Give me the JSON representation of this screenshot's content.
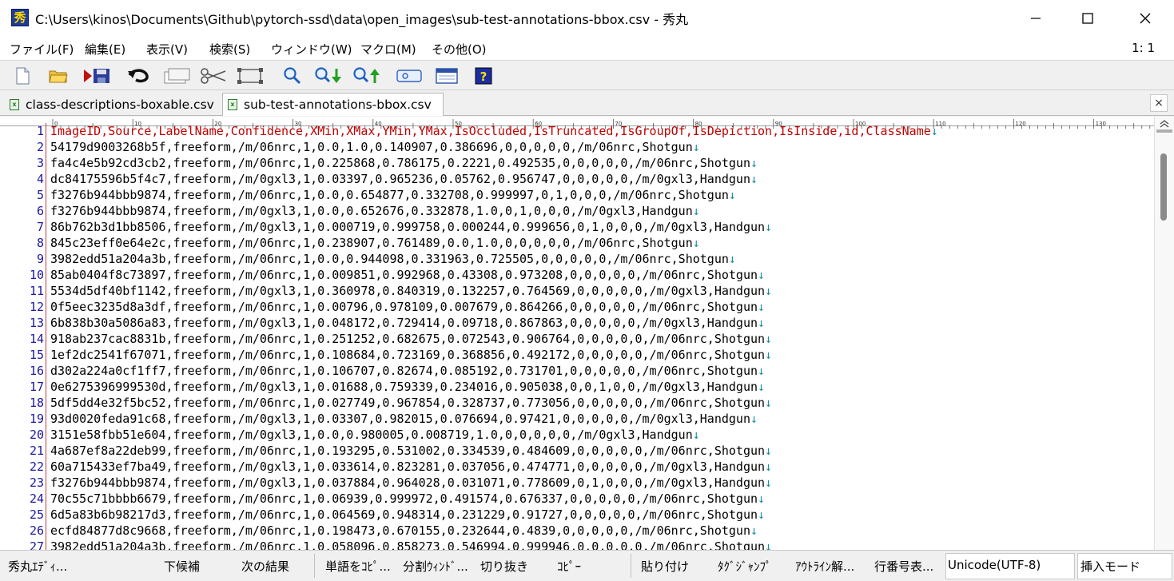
{
  "window": {
    "title": "C:\\Users\\kinos\\Documents\\Github\\pytorch-ssd\\data\\open_images\\sub-test-annotations-bbox.csv - 秀丸",
    "app_icon_glyph": "秀"
  },
  "menu": {
    "items": [
      "ファイル(F)",
      "編集(E)",
      "表示(V)",
      "検索(S)",
      "ウィンドウ(W)",
      "マクロ(M)",
      "その他(O)"
    ],
    "cursor_position": "1: 1"
  },
  "toolbar": {
    "icons": [
      "new-file-icon",
      "open-folder-icon",
      "save-icon",
      "undo-icon",
      "copy-icon",
      "cut-icon",
      "paste-icon",
      "search-icon",
      "search-next-icon",
      "search-prev-icon",
      "grep-icon",
      "window-icon",
      "help-icon"
    ]
  },
  "tabs": [
    {
      "label": "class-descriptions-boxable.csv",
      "active": false
    },
    {
      "label": "sub-test-annotations-bbox.csv",
      "active": true
    }
  ],
  "ruler": {
    "ticks": [
      "0",
      "10",
      "20",
      "30",
      "40",
      "50",
      "60",
      "70",
      "80",
      "90",
      "100",
      "110",
      "120",
      "130"
    ]
  },
  "editor": {
    "lines": [
      {
        "n": "1",
        "text": "ImageID,Source,LabelName,Confidence,XMin,XMax,YMin,YMax,IsOccluded,IsTruncated,IsGroupOf,IsDepiction,IsInside,id,ClassName"
      },
      {
        "n": "2",
        "text": "54179d9003268b5f,freeform,/m/06nrc,1,0.0,1.0,0.140907,0.386696,0,0,0,0,0,/m/06nrc,Shotgun"
      },
      {
        "n": "3",
        "text": "fa4c4e5b92cd3cb2,freeform,/m/06nrc,1,0.225868,0.786175,0.2221,0.492535,0,0,0,0,0,/m/06nrc,Shotgun"
      },
      {
        "n": "4",
        "text": "dc84175596b5f4c7,freeform,/m/0gxl3,1,0.03397,0.965236,0.05762,0.956747,0,0,0,0,0,/m/0gxl3,Handgun"
      },
      {
        "n": "5",
        "text": "f3276b944bbb9874,freeform,/m/06nrc,1,0.0,0.654877,0.332708,0.999997,0,1,0,0,0,/m/06nrc,Shotgun"
      },
      {
        "n": "6",
        "text": "f3276b944bbb9874,freeform,/m/0gxl3,1,0.0,0.652676,0.332878,1.0,0,1,0,0,0,/m/0gxl3,Handgun"
      },
      {
        "n": "7",
        "text": "86b762b3d1bb8506,freeform,/m/0gxl3,1,0.000719,0.999758,0.000244,0.999656,0,1,0,0,0,/m/0gxl3,Handgun"
      },
      {
        "n": "8",
        "text": "845c23eff0e64e2c,freeform,/m/06nrc,1,0.238907,0.761489,0.0,1.0,0,0,0,0,0,/m/06nrc,Shotgun"
      },
      {
        "n": "9",
        "text": "3982edd51a204a3b,freeform,/m/06nrc,1,0.0,0.944098,0.331963,0.725505,0,0,0,0,0,/m/06nrc,Shotgun"
      },
      {
        "n": "10",
        "text": "85ab0404f8c73897,freeform,/m/06nrc,1,0.009851,0.992968,0.43308,0.973208,0,0,0,0,0,/m/06nrc,Shotgun"
      },
      {
        "n": "11",
        "text": "5534d5df40bf1142,freeform,/m/0gxl3,1,0.360978,0.840319,0.132257,0.764569,0,0,0,0,0,/m/0gxl3,Handgun"
      },
      {
        "n": "12",
        "text": "0f5eec3235d8a3df,freeform,/m/06nrc,1,0.00796,0.978109,0.007679,0.864266,0,0,0,0,0,/m/06nrc,Shotgun"
      },
      {
        "n": "13",
        "text": "6b838b30a5086a83,freeform,/m/0gxl3,1,0.048172,0.729414,0.09718,0.867863,0,0,0,0,0,/m/0gxl3,Handgun"
      },
      {
        "n": "14",
        "text": "918ab237cac8831b,freeform,/m/06nrc,1,0.251252,0.682675,0.072543,0.906764,0,0,0,0,0,/m/06nrc,Shotgun"
      },
      {
        "n": "15",
        "text": "1ef2dc2541f67071,freeform,/m/06nrc,1,0.108684,0.723169,0.368856,0.492172,0,0,0,0,0,/m/06nrc,Shotgun"
      },
      {
        "n": "16",
        "text": "d302a224a0cf1ff7,freeform,/m/06nrc,1,0.106707,0.82674,0.085192,0.731701,0,0,0,0,0,/m/06nrc,Shotgun"
      },
      {
        "n": "17",
        "text": "0e6275396999530d,freeform,/m/0gxl3,1,0.01688,0.759339,0.234016,0.905038,0,0,1,0,0,/m/0gxl3,Handgun"
      },
      {
        "n": "18",
        "text": "5df5dd4e32f5bc52,freeform,/m/06nrc,1,0.027749,0.967854,0.328737,0.773056,0,0,0,0,0,/m/06nrc,Shotgun"
      },
      {
        "n": "19",
        "text": "93d0020feda91c68,freeform,/m/0gxl3,1,0.03307,0.982015,0.076694,0.97421,0,0,0,0,0,/m/0gxl3,Handgun"
      },
      {
        "n": "20",
        "text": "3151e58fbb51e604,freeform,/m/0gxl3,1,0.0,0.980005,0.008719,1.0,0,0,0,0,0,/m/0gxl3,Handgun"
      },
      {
        "n": "21",
        "text": "4a687ef8a22deb99,freeform,/m/06nrc,1,0.193295,0.531002,0.334539,0.484609,0,0,0,0,0,/m/06nrc,Shotgun"
      },
      {
        "n": "22",
        "text": "60a715433ef7ba49,freeform,/m/0gxl3,1,0.033614,0.823281,0.037056,0.474771,0,0,0,0,0,/m/0gxl3,Handgun"
      },
      {
        "n": "23",
        "text": "f3276b944bbb9874,freeform,/m/0gxl3,1,0.037884,0.964028,0.031071,0.778609,0,1,0,0,0,/m/0gxl3,Handgun"
      },
      {
        "n": "24",
        "text": "70c55c71bbbb6679,freeform,/m/06nrc,1,0.06939,0.999972,0.491574,0.676337,0,0,0,0,0,/m/06nrc,Shotgun"
      },
      {
        "n": "25",
        "text": "6d5a83b6b98217d3,freeform,/m/06nrc,1,0.064569,0.948314,0.231229,0.91727,0,0,0,0,0,/m/06nrc,Shotgun"
      },
      {
        "n": "26",
        "text": "ecfd84877d8c9668,freeform,/m/06nrc,1,0.198473,0.670155,0.232644,0.4839,0,0,0,0,0,/m/06nrc,Shotgun"
      },
      {
        "n": "27",
        "text": "3982edd51a204a3b,freeform,/m/06nrc,1,0.058096,0.858273,0.546994,0.999946,0,0,0,0,0,/m/06nrc,Shotgun"
      }
    ],
    "eol_glyph": "↓"
  },
  "status": {
    "items": [
      "秀丸ｴﾃﾞｨ...",
      "下候補",
      "次の結果",
      "単語をｺﾋﾟ...",
      "分割ｳｨﾝﾄﾞ...",
      "切り抜き",
      "ｺﾋﾟｰ",
      "貼り付け",
      "ﾀｸﾞｼﾞｬﾝﾌﾟ",
      "ｱｳﾄﾗｲﾝ解...",
      "行番号表..."
    ],
    "encoding": "Unicode(UTF-8)",
    "mode": "挿入モード"
  },
  "colors": {
    "header_text": "#c00000",
    "line_numbers": "#1a1aa0",
    "eol_marker": "#1a8fa0"
  }
}
